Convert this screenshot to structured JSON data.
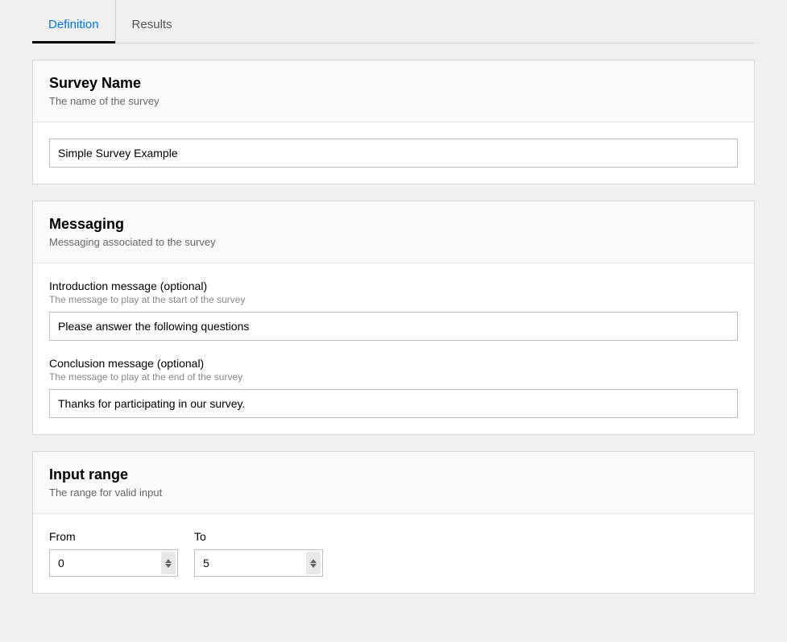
{
  "tabs": {
    "definition": "Definition",
    "results": "Results"
  },
  "surveyName": {
    "title": "Survey Name",
    "subtitle": "The name of the survey",
    "value": "Simple Survey Example"
  },
  "messaging": {
    "title": "Messaging",
    "subtitle": "Messaging associated to the survey",
    "intro": {
      "label": "Introduction message (optional)",
      "help": "The message to play at the start of the survey",
      "value": "Please answer the following questions"
    },
    "conclusion": {
      "label": "Conclusion message (optional)",
      "help": "The message to play at the end of the survey",
      "value": "Thanks for participating in our survey."
    }
  },
  "inputRange": {
    "title": "Input range",
    "subtitle": "The range for valid input",
    "from": {
      "label": "From",
      "value": "0"
    },
    "to": {
      "label": "To",
      "value": "5"
    }
  }
}
